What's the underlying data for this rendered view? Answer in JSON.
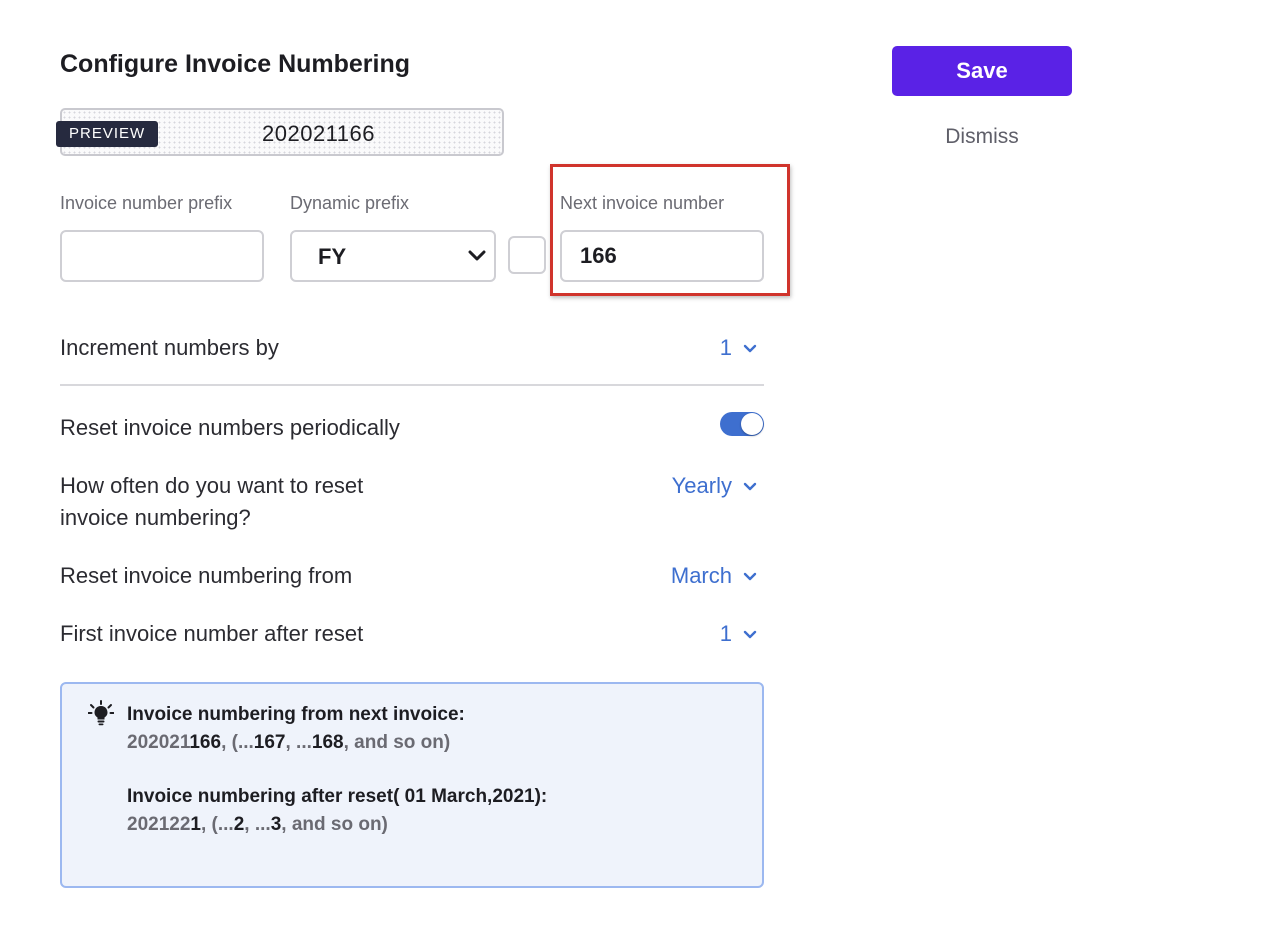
{
  "page": {
    "title": "Configure Invoice Numbering"
  },
  "preview": {
    "badge": "PREVIEW",
    "value": "202021166"
  },
  "fields": {
    "prefix": {
      "label": "Invoice number prefix",
      "value": ""
    },
    "dynamic_prefix": {
      "label": "Dynamic prefix",
      "selected": "FY"
    },
    "next_number": {
      "label": "Next invoice number",
      "value": "166"
    }
  },
  "settings": {
    "increment": {
      "label": "Increment numbers by",
      "value": "1"
    },
    "reset_periodically": {
      "label": "Reset invoice numbers periodically",
      "enabled": true
    },
    "reset_frequency": {
      "label_line1": "How often do you want to reset",
      "label_line2": "invoice numbering?",
      "value": "Yearly"
    },
    "reset_from": {
      "label": "Reset invoice numbering from",
      "value": "March"
    },
    "first_after_reset": {
      "label": "First invoice number after reset",
      "value": "1"
    }
  },
  "info": {
    "icon": "lightbulb-icon",
    "next": {
      "heading": "Invoice numbering from next invoice:",
      "prefix": "202021",
      "n1": "166",
      "sep1": ", (...",
      "n2": "167",
      "sep2": ", ...",
      "n3": "168",
      "suffix": ", and so on)"
    },
    "reset": {
      "heading": "Invoice numbering after reset( 01 March,2021):",
      "prefix": "202122",
      "n1": "1",
      "sep1": ", (...",
      "n2": "2",
      "sep2": ", ...",
      "n3": "3",
      "suffix": ", and so on)"
    }
  },
  "actions": {
    "save": "Save",
    "dismiss": "Dismiss"
  },
  "colors": {
    "accent": "#5a22e6",
    "link": "#3e6fcf",
    "highlight": "#d0342c"
  }
}
